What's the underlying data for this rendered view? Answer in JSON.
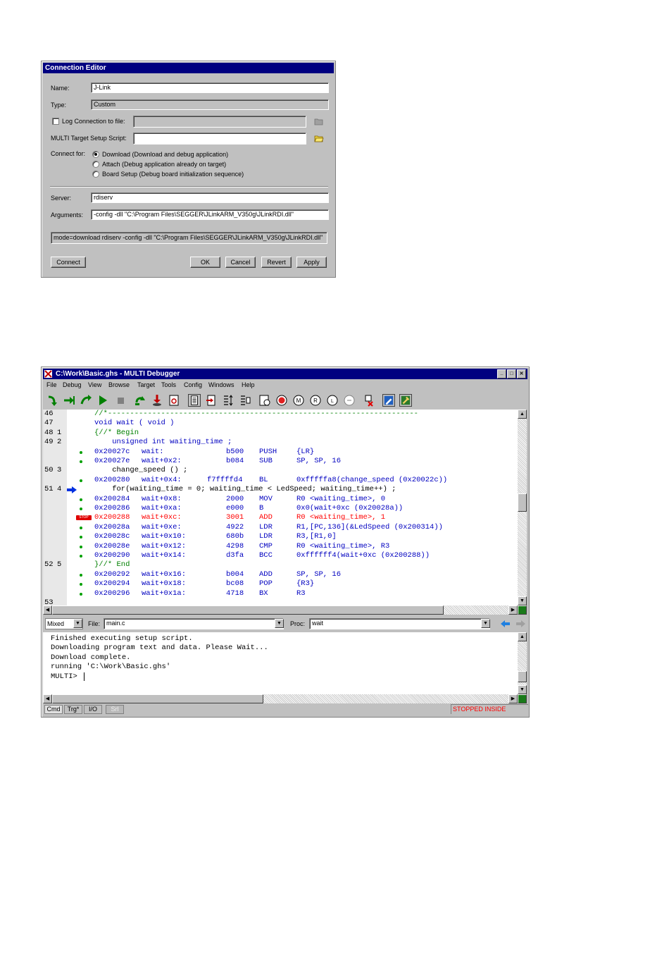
{
  "connection_editor": {
    "title": "Connection Editor",
    "name_label": "Name:",
    "name_value": "J-Link",
    "type_label": "Type:",
    "type_value": "Custom",
    "log_label": "Log Connection to file:",
    "log_checked": false,
    "log_value": "",
    "script_label": "MULTI Target Setup Script:",
    "script_value": "",
    "connect_for_label": "Connect for:",
    "options": [
      "Download (Download and debug application)",
      "Attach (Debug application already on target)",
      "Board Setup (Debug board initialization sequence)"
    ],
    "selected_option": 0,
    "server_label": "Server:",
    "server_value": "rdiserv",
    "arguments_label": "Arguments:",
    "arguments_value": "-config -dll \"C:\\Program Files\\SEGGER\\JLinkARM_V350g\\JLinkRDI.dll\"",
    "command_line": "mode=download rdiserv -config -dll \"C:\\Program Files\\SEGGER\\JLinkARM_V350g\\JLinkRDI.dll\"",
    "buttons": {
      "connect": "Connect",
      "ok": "OK",
      "cancel": "Cancel",
      "revert": "Revert",
      "apply": "Apply"
    }
  },
  "debugger": {
    "title": "C:\\Work\\Basic.ghs - MULTI Debugger",
    "menu": [
      "File",
      "Debug",
      "View",
      "Browse",
      "Target",
      "Tools",
      "Config",
      "Windows",
      "Help"
    ],
    "toolbar_icons": [
      "step-over-icon",
      "step-into-icon",
      "step-out-icon",
      "run-icon",
      "stop-icon",
      "restart-icon",
      "download-icon",
      "reload-icon",
      "source-view-icon",
      "go-to-pc-icon",
      "breakpoints-icon",
      "registers-view-icon",
      "memory-icon",
      "stop-sign-icon",
      "memory-view-icon",
      "register-icon",
      "local-vars-icon",
      "call-stack-icon",
      "disconnect-icon",
      "edit-icon",
      "hammer-icon"
    ],
    "source_lines": [
      {
        "kind": "src",
        "ln": "46",
        "bl": "",
        "text": "//*----------------------------------------------------------------------",
        "style": "grn"
      },
      {
        "kind": "src",
        "ln": "47",
        "bl": "",
        "text": "void wait ( void )",
        "style": ""
      },
      {
        "kind": "src",
        "ln": "48",
        "bl": "1",
        "text": "{//* Begin",
        "style": "grn"
      },
      {
        "kind": "src",
        "ln": "49",
        "bl": "2",
        "text": "    unsigned int waiting_time ;",
        "style": ""
      },
      {
        "kind": "asm",
        "addr": "0x20027c",
        "label": "wait:",
        "hex": "b500",
        "op": "PUSH",
        "arg": "{LR}"
      },
      {
        "kind": "asm",
        "addr": "0x20027e",
        "label": "wait+0x2:",
        "hex": "b084",
        "op": "SUB",
        "arg": "SP, SP, 16"
      },
      {
        "kind": "src",
        "ln": "50",
        "bl": "3",
        "text": "    change_speed () ;",
        "style": "blk"
      },
      {
        "kind": "asm",
        "addr": "0x200280",
        "label": "wait+0x4:",
        "hex": "f7ffffd4",
        "op": "BL",
        "arg": "0xfffffa8(change_speed (0x20022c))",
        "hexwide": true
      },
      {
        "kind": "src",
        "ln": "51",
        "bl": "4",
        "text": "    for(waiting_time = 0; waiting_time < LedSpeed; waiting_time++) ;",
        "style": "blk",
        "pc": true
      },
      {
        "kind": "asm",
        "addr": "0x200284",
        "label": "wait+0x8:",
        "hex": "2000",
        "op": "MOV",
        "arg": "R0 <waiting_time>, 0"
      },
      {
        "kind": "asm",
        "addr": "0x200286",
        "label": "wait+0xa:",
        "hex": "e000",
        "op": "B",
        "arg": "0x0(wait+0xc (0x20028a))"
      },
      {
        "kind": "asm",
        "addr": "0x200288",
        "label": "wait+0xc:",
        "hex": "3001",
        "op": "ADD",
        "arg": "R0 <waiting_time>, 1",
        "red": true
      },
      {
        "kind": "asm",
        "addr": "0x20028a",
        "label": "wait+0xe:",
        "hex": "4922",
        "op": "LDR",
        "arg": "R1,[PC,136](&LedSpeed (0x200314))"
      },
      {
        "kind": "asm",
        "addr": "0x20028c",
        "label": "wait+0x10:",
        "hex": "680b",
        "op": "LDR",
        "arg": "R3,[R1,0]"
      },
      {
        "kind": "asm",
        "addr": "0x20028e",
        "label": "wait+0x12:",
        "hex": "4298",
        "op": "CMP",
        "arg": "R0 <waiting_time>, R3"
      },
      {
        "kind": "asm",
        "addr": "0x200290",
        "label": "wait+0x14:",
        "hex": "d3fa",
        "op": "BCC",
        "arg": "0xffffff4(wait+0xc (0x200288))"
      },
      {
        "kind": "src",
        "ln": "52",
        "bl": "5",
        "text": "}//* End",
        "style": "grn"
      },
      {
        "kind": "asm",
        "addr": "0x200292",
        "label": "wait+0x16:",
        "hex": "b004",
        "op": "ADD",
        "arg": "SP, SP, 16"
      },
      {
        "kind": "asm",
        "addr": "0x200294",
        "label": "wait+0x18:",
        "hex": "bc08",
        "op": "POP",
        "arg": "{R3}"
      },
      {
        "kind": "asm",
        "addr": "0x200296",
        "label": "wait+0x1a:",
        "hex": "4718",
        "op": "BX",
        "arg": "R3"
      },
      {
        "kind": "src",
        "ln": "53",
        "bl": "",
        "text": "",
        "style": ""
      }
    ],
    "bp_marker": "STOP",
    "view_mode": "Mixed",
    "file_label": "File:",
    "file_value": "main.c",
    "proc_label": "Proc:",
    "proc_value": "wait",
    "command_output": [
      "Finished executing setup script.",
      "Downloading program text and data. Please Wait...",
      "Download complete.",
      "running 'C:\\Work\\Basic.ghs'",
      "MULTI> "
    ],
    "tabs": [
      "Cmd",
      "Trg*",
      "I/O",
      "Srl"
    ],
    "status": "STOPPED INSIDE",
    "status_color": "#ff0000"
  }
}
